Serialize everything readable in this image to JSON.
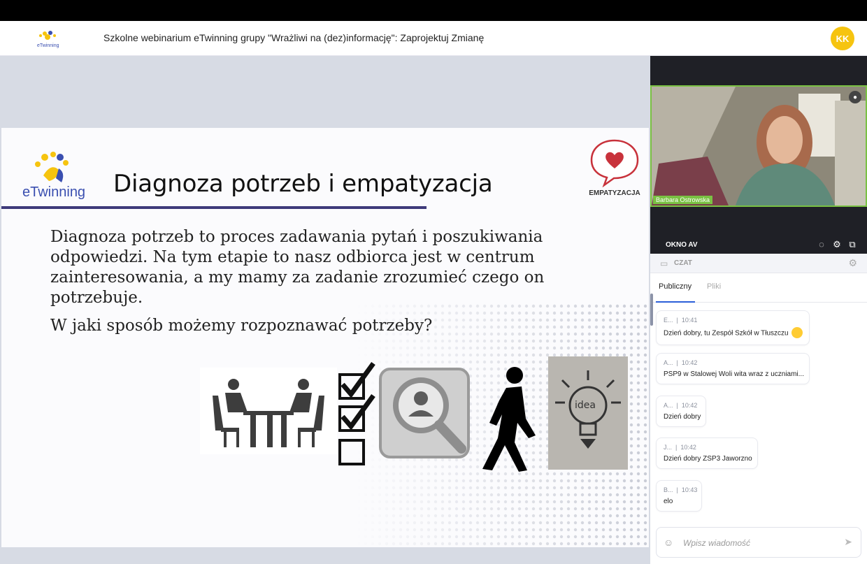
{
  "header": {
    "logo_text": "eTwinning",
    "title": "Szkolne webinarium eTwinning grupy \"Wrażliwi na (dez)informację\": Zaprojektuj Zmianę",
    "avatar_initials": "KK"
  },
  "slide": {
    "logo_text": "eTwinning",
    "title": "Diagnoza potrzeb i empatyzacja",
    "badge_label": "EMPATYZACJA",
    "body_lines": [
      "Diagnoza potrzeb to proces zadawania pytań i poszukiwania",
      "odpowiedzi. Na tym etapie to nasz odbiorca jest w centrum",
      "zainteresowania, a my mamy za zadanie zrozumieć czego on",
      "potrzebuje."
    ],
    "question": "W jaki sposób możemy rozpoznawać potrzeby?",
    "idea_label": "idea"
  },
  "video": {
    "participant_name": "Barbara Ostrowska",
    "window_label": "OKNO AV"
  },
  "chat": {
    "header_label": "CZAT",
    "tabs": [
      {
        "label": "Publiczny",
        "active": true
      },
      {
        "label": "Pliki",
        "active": false
      }
    ],
    "messages": [
      {
        "author": "E...",
        "time": "10:41",
        "text": "Dzień dobry, tu Zespół Szkół w Tłuszczu",
        "emoji": "smile"
      },
      {
        "author": "A...",
        "time": "10:42",
        "text": "PSP9 w Stalowej Woli wita wraz z uczniami..."
      },
      {
        "author": "A...",
        "time": "10:42",
        "text": "Dzień dobry"
      },
      {
        "author": "J...",
        "time": "10:42",
        "text": "Dzień dobry ZSP3 Jaworzno"
      },
      {
        "author": "B...",
        "time": "10:43",
        "text": "elo"
      }
    ],
    "input_placeholder": "Wpisz wiadomość",
    "input_value": ""
  },
  "colors": {
    "accent_yellow": "#f6c40f",
    "video_border": "#7ac143",
    "slide_underline": "#3e3a7a",
    "tab_active": "#2b5fd9"
  },
  "icons": {
    "mic": "mic-icon",
    "chat_toggle": "chat-bubble-icon",
    "settings": "gear-icon",
    "popout": "popout-icon",
    "chat_header": "chat-icon",
    "emoji_picker": "smiley-icon",
    "send": "send-icon"
  }
}
